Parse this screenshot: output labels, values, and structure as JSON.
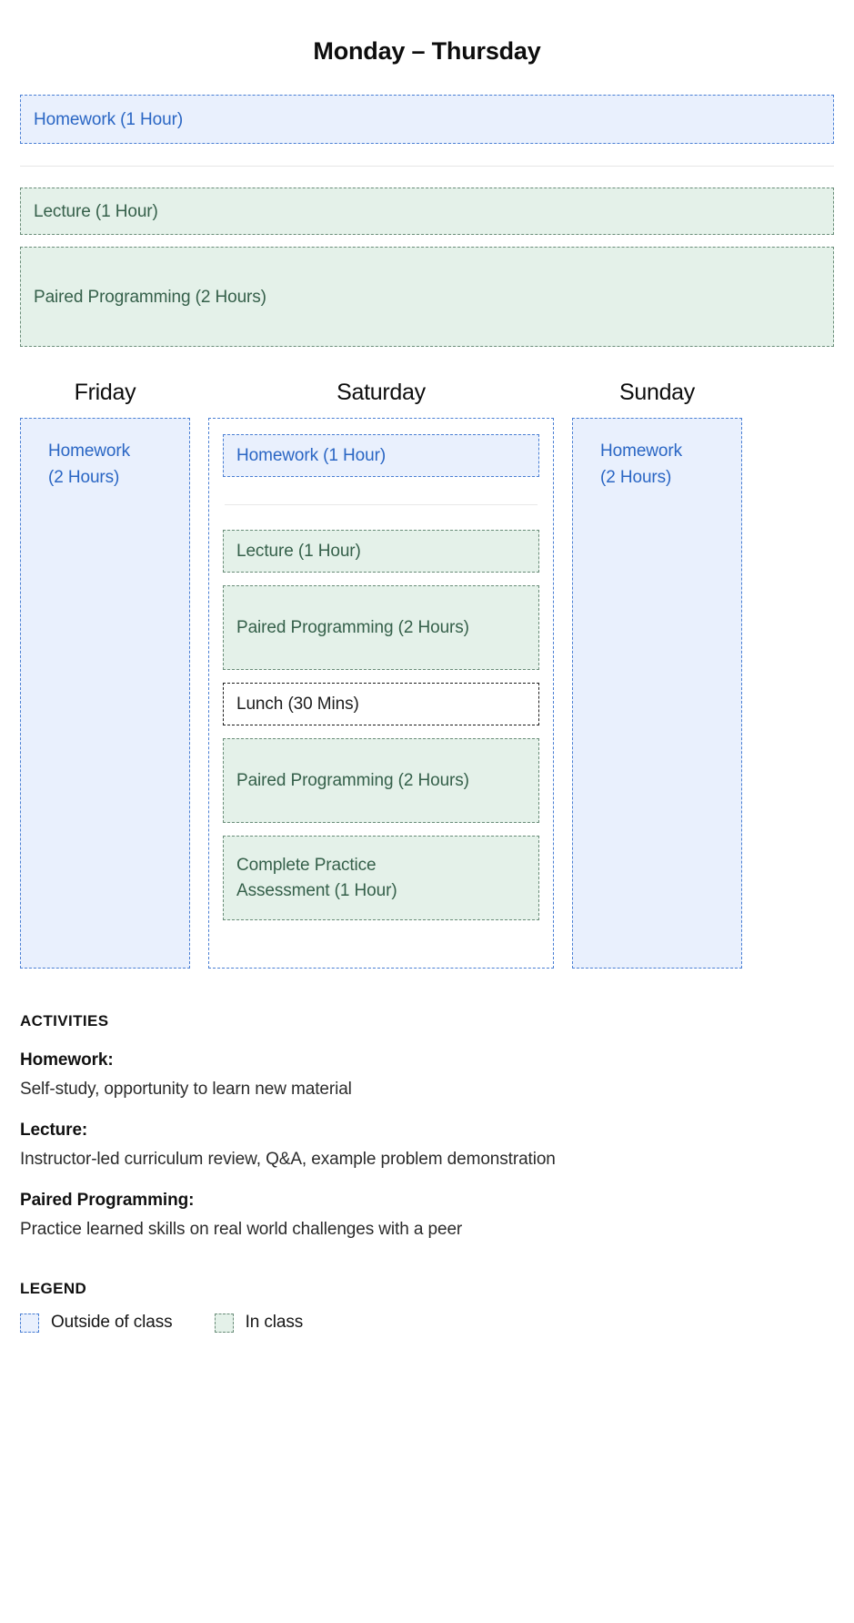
{
  "weekday_section": {
    "title": "Monday – Thursday",
    "blocks": [
      {
        "label": "Homework (1 Hour)",
        "kind": "outside"
      },
      {
        "label": "Lecture (1 Hour)",
        "kind": "inclass"
      },
      {
        "label": "Paired Programming (2 Hours)",
        "kind": "inclass"
      }
    ]
  },
  "weekend_section": {
    "days": [
      {
        "name": "Friday"
      },
      {
        "name": "Saturday"
      },
      {
        "name": "Sunday"
      }
    ],
    "friday": {
      "label": "Homework\n(2 Hours)",
      "kind": "outside"
    },
    "sunday": {
      "label": "Homework\n(2 Hours)",
      "kind": "outside"
    },
    "saturday": {
      "blocks": [
        {
          "label": "Homework (1 Hour)",
          "kind": "outside"
        },
        {
          "label": "Lecture (1 Hour)",
          "kind": "inclass"
        },
        {
          "label": "Paired Programming (2 Hours)",
          "kind": "inclass"
        },
        {
          "label": "Lunch (30 Mins)",
          "kind": "neutral"
        },
        {
          "label": "Paired Programming (2 Hours)",
          "kind": "inclass"
        },
        {
          "label": "Complete Practice\nAssessment (1 Hour)",
          "kind": "inclass"
        }
      ]
    }
  },
  "activities": {
    "heading": "ACTIVITIES",
    "items": [
      {
        "term": "Homework:",
        "desc": "Self-study, opportunity to learn new material"
      },
      {
        "term": "Lecture:",
        "desc": "Instructor-led curriculum review, Q&A, example problem demonstration"
      },
      {
        "term": "Paired Programming:",
        "desc": "Practice learned skills on real world challenges with a peer"
      }
    ]
  },
  "legend": {
    "heading": "LEGEND",
    "items": [
      {
        "label": "Outside of class",
        "swatch": "outside-of-class-swatch"
      },
      {
        "label": "In class",
        "swatch": "in-class-swatch"
      }
    ]
  },
  "colors": {
    "outside_bg": "#e9f0fd",
    "outside_border": "#4a7fd4",
    "outside_text": "#2a66c4",
    "inclass_bg": "#e4f1e9",
    "inclass_border": "#6a8d79",
    "inclass_text": "#35604a",
    "neutral_border": "#1d1d1d",
    "divider": "#e6e6e6"
  }
}
